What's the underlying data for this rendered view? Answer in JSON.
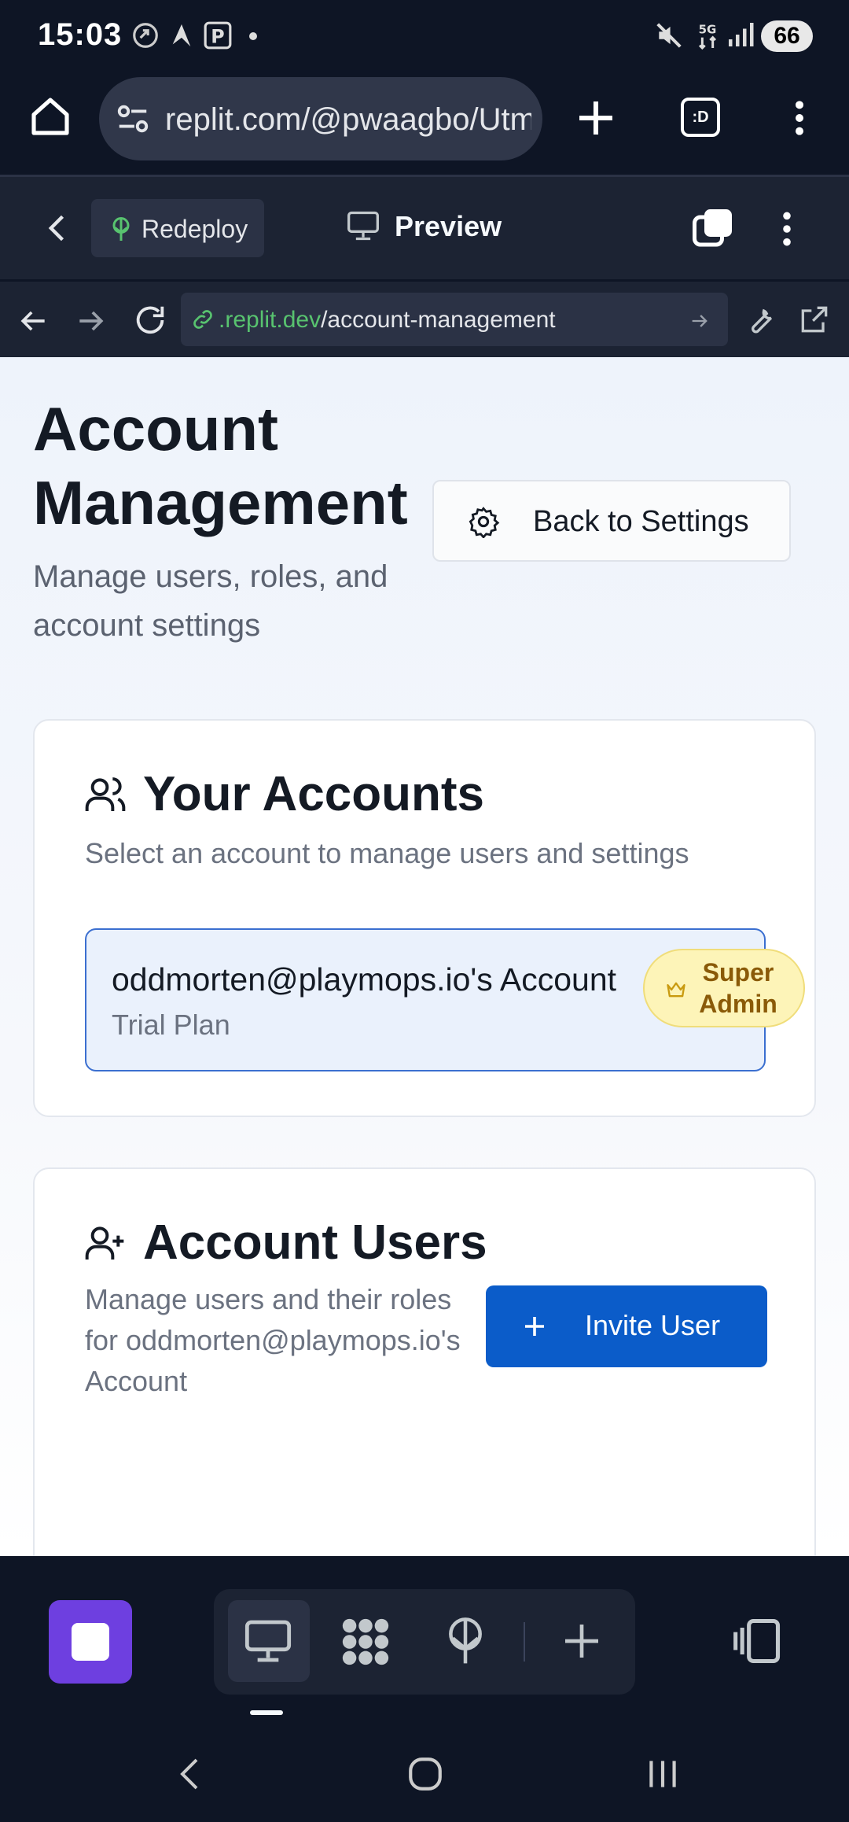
{
  "status_bar": {
    "time": "15:03",
    "battery": "66",
    "icons": [
      "sync-icon",
      "notification-icon",
      "parking-icon",
      "dot-icon",
      "mute-icon",
      "5g-icon",
      "signal-icon"
    ]
  },
  "browser": {
    "url": "replit.com/@pwaagbo/Utm",
    "icons": [
      "home-icon",
      "site-settings-icon",
      "new-tab-icon",
      "tab-switcher-icon",
      "menu-icon"
    ],
    "tab_switcher_label": ":D"
  },
  "replit_header": {
    "redeploy_label": "Redeploy",
    "preview_label": "Preview"
  },
  "webview_nav": {
    "address_domain": ".replit.dev",
    "address_path": "/account-management"
  },
  "page": {
    "title": "Account Management",
    "subtitle": "Manage users, roles, and account settings",
    "back_button": "Back to Settings",
    "accounts_card": {
      "title": "Your Accounts",
      "description": "Select an account to manage users and settings",
      "account_name": "oddmorten@playmops.io's Account",
      "account_plan": "Trial Plan",
      "role_badge": "Super Admin"
    },
    "users_card": {
      "title": "Account Users",
      "description": "Manage users and their roles for oddmorten@playmops.io's Account",
      "invite_button": "Invite User"
    }
  },
  "colors": {
    "accent_blue": "#0b5cc9",
    "badge_yellow": "#fdf4b8",
    "stop_purple": "#6e3fe0",
    "link_green": "#58c36f"
  }
}
